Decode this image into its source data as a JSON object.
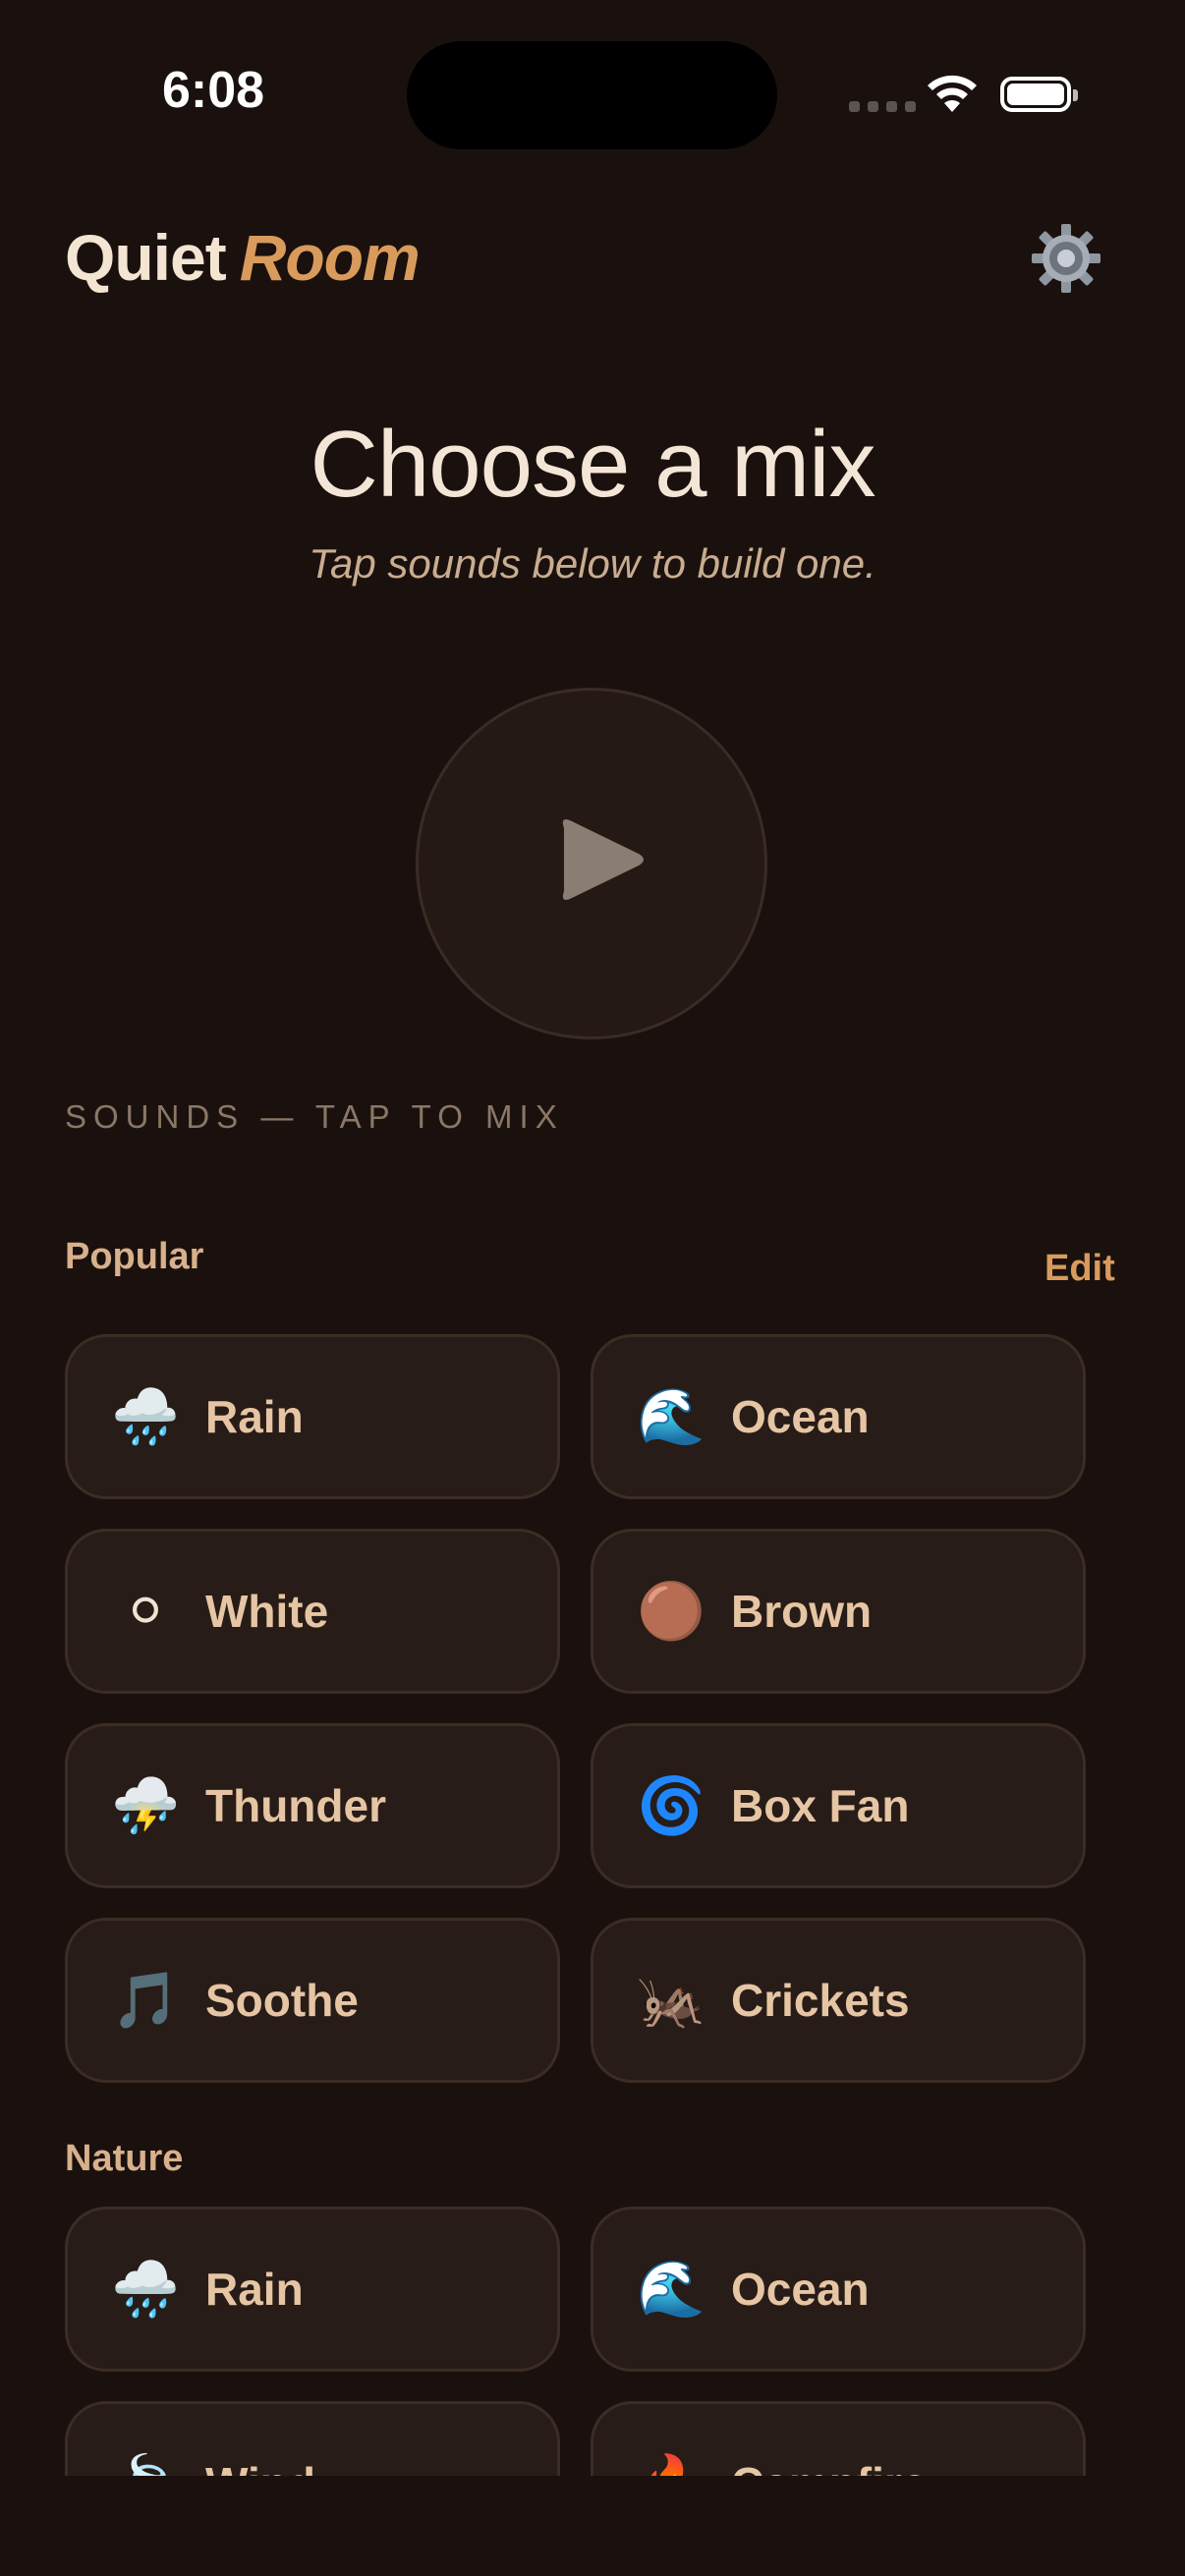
{
  "status": {
    "time": "6:08"
  },
  "header": {
    "title_main": "Quiet",
    "title_accent": "Room",
    "settings_icon": "gear-icon"
  },
  "hero": {
    "title": "Choose a mix",
    "subtitle": "Tap sounds below to build one."
  },
  "player": {
    "play_icon": "play-icon"
  },
  "sounds": {
    "caption": "SOUNDS — TAP TO MIX",
    "popular": {
      "title": "Popular",
      "edit_label": "Edit",
      "items": [
        {
          "emoji": "🌧️",
          "label": "Rain"
        },
        {
          "emoji": "🌊",
          "label": "Ocean"
        },
        {
          "emoji": "⚪",
          "label": "White"
        },
        {
          "emoji": "🟤",
          "label": "Brown"
        },
        {
          "emoji": "⛈️",
          "label": "Thunder"
        },
        {
          "emoji": "🌀",
          "label": "Box Fan"
        },
        {
          "emoji": "🎵",
          "label": "Soothe"
        },
        {
          "emoji": "🦗",
          "label": "Crickets"
        }
      ]
    },
    "nature": {
      "title": "Nature",
      "items": [
        {
          "emoji": "🌧️",
          "label": "Rain"
        },
        {
          "emoji": "🌊",
          "label": "Ocean"
        },
        {
          "emoji": "🍃",
          "label": "Wind"
        },
        {
          "emoji": "🔥",
          "label": "Campfire"
        }
      ]
    }
  },
  "colors": {
    "background": "#1a110e",
    "accent": "#d99b5c",
    "tile": "#271c17",
    "tile_border": "#3c2d24"
  }
}
